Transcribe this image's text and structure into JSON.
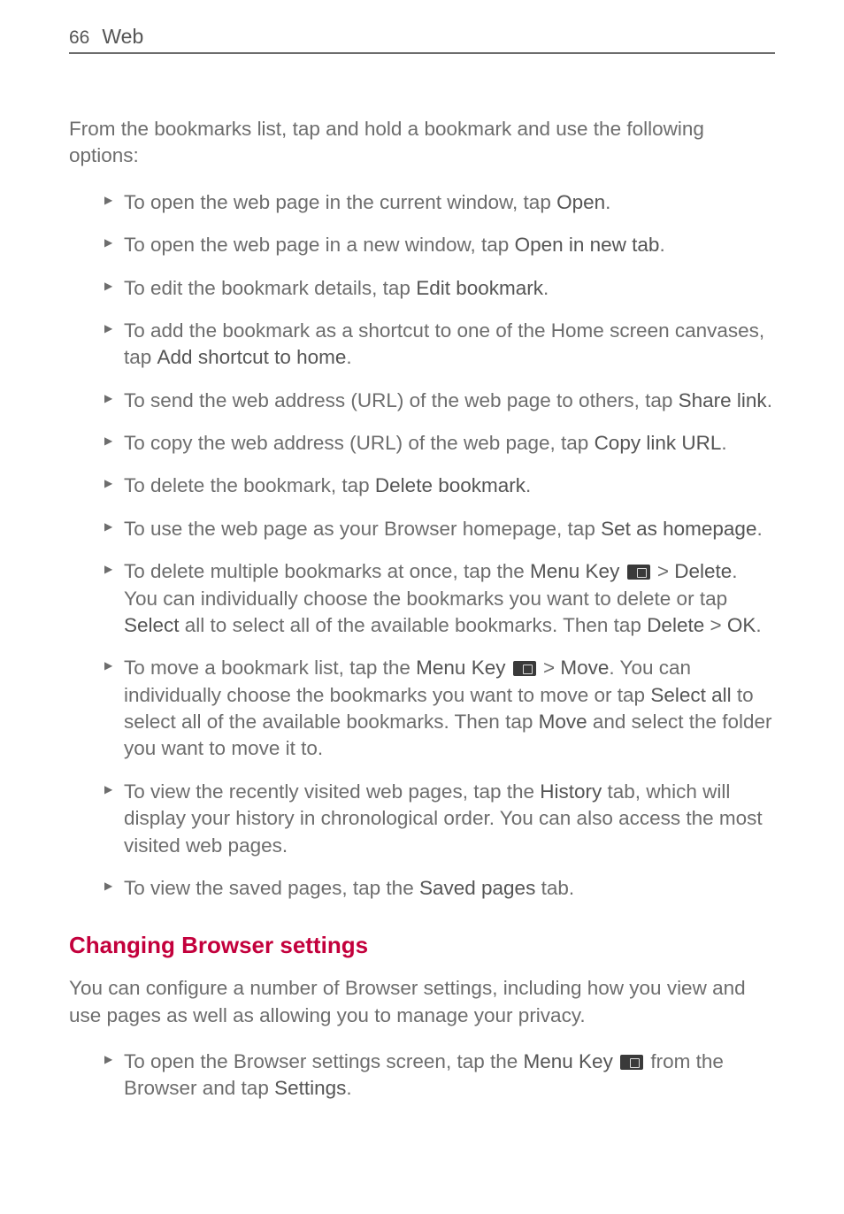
{
  "header": {
    "page_number": "66",
    "section": "Web"
  },
  "intro": "From the bookmarks list, tap and hold a bookmark and use the following options:",
  "items": [
    {
      "pre": "To open the web page in the current window, tap ",
      "b1": "Open",
      "post1": "."
    },
    {
      "pre": "To open the web page in a new window, tap ",
      "b1": "Open in new tab",
      "post1": "."
    },
    {
      "pre": "To edit the bookmark details, tap ",
      "b1": "Edit bookmark",
      "post1": "."
    },
    {
      "pre": "To add the bookmark as a shortcut to one of the Home screen canvases, tap ",
      "b1": "Add shortcut to home",
      "post1": "."
    },
    {
      "pre": "To send the web address (URL) of the web page to others, tap ",
      "b1": "Share link",
      "post1": "."
    },
    {
      "pre": "To copy the web address (URL) of the web page, tap ",
      "b1": "Copy link URL",
      "post1": "."
    },
    {
      "pre": "To delete the bookmark, tap ",
      "b1": "Delete bookmark",
      "post1": "."
    },
    {
      "pre": "To use the web page as your Browser homepage, tap ",
      "b1": "Set as homepage",
      "post1": "."
    }
  ],
  "item_delete_multi": {
    "pre": "To delete multiple bookmarks at once, tap the ",
    "b1": "Menu Key",
    "mid1": " > ",
    "b2": "Delete",
    "mid2": ". You can individually choose the bookmarks you want to delete or tap ",
    "b3": "Select",
    "mid3": " all to select all of the available bookmarks. Then tap ",
    "b4": "Delete",
    "mid4": " > ",
    "b5": "OK",
    "post": "."
  },
  "item_move": {
    "pre": "To move a bookmark list, tap the ",
    "b1": "Menu Key",
    "mid1": " > ",
    "b2": "Move",
    "mid2": ". You can individually choose the bookmarks you want to move or tap ",
    "b3": "Select all",
    "mid3": " to select all of the available bookmarks. Then tap ",
    "b4": "Move",
    "post": " and select the folder you want to move it to."
  },
  "item_history": {
    "pre": "To view the recently visited web pages, tap the ",
    "b1": "History",
    "post": " tab, which will display your history in chronological order. You can also access the most visited web pages."
  },
  "item_saved": {
    "pre": "To view the saved pages, tap the ",
    "b1": "Saved pages",
    "post": " tab."
  },
  "heading2": "Changing Browser settings",
  "para2": "You can configure a number of Browser settings, including how you view and use pages as well as allowing you to manage your privacy.",
  "item_settings": {
    "pre": "To open the Browser settings screen, tap the ",
    "b1": "Menu Key",
    "mid1": " from the Browser and tap ",
    "b2": "Settings",
    "post": "."
  }
}
